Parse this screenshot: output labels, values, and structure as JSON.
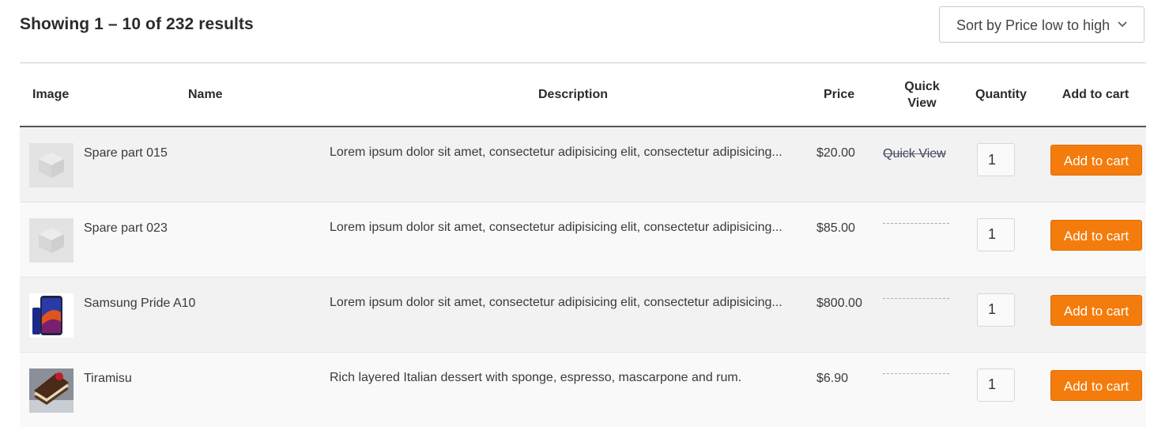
{
  "results": {
    "text": "Showing 1 – 10 of 232 results"
  },
  "sort": {
    "label": "Sort by Price low to high"
  },
  "table": {
    "headers": {
      "image": "Image",
      "name": "Name",
      "description": "Description",
      "price": "Price",
      "quick_view_line1": "Quick",
      "quick_view_line2": "View",
      "quantity": "Quantity",
      "add_to_cart": "Add to cart"
    },
    "rows": [
      {
        "name": "Spare part 015",
        "description": "Lorem ipsum dolor sit amet, consectetur adipisicing elit, consectetur adipisicing...",
        "price": "$20.00",
        "quick_view": "Quick View",
        "quantity": "1",
        "cart_label": "Add to cart",
        "thumb": "placeholder-cube-icon"
      },
      {
        "name": "Spare part 023",
        "description": "Lorem ipsum dolor sit amet, consectetur adipisicing elit, consectetur adipisicing...",
        "price": "$85.00",
        "quantity": "1",
        "cart_label": "Add to cart",
        "thumb": "placeholder-cube-icon"
      },
      {
        "name": "Samsung Pride A10",
        "description": "Lorem ipsum dolor sit amet, consectetur adipisicing elit, consectetur adipisicing...",
        "price": "$800.00",
        "quantity": "1",
        "cart_label": "Add to cart",
        "thumb": "smartphone-image"
      },
      {
        "name": "Tiramisu",
        "description": "Rich layered Italian dessert with sponge, espresso, mascarpone and rum.",
        "price": "$6.90",
        "quantity": "1",
        "cart_label": "Add to cart",
        "thumb": "dessert-image"
      }
    ]
  },
  "colors": {
    "accent": "#f47c0c",
    "row_odd": "#f2f2f2",
    "row_even": "#f9f9f9"
  }
}
